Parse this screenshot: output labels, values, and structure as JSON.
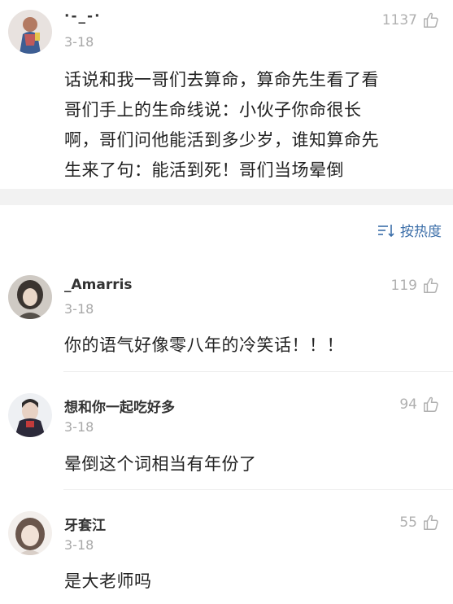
{
  "top_comment": {
    "username": "·-_-·",
    "date": "3-18",
    "likes": "1137",
    "text_lines": [
      "话说和我一哥们去算命，算命先生看了看",
      "哥们手上的生命线说：小伙子你命很长",
      "啊，哥们问他能活到多少岁，谁知算命先",
      "生来了句：能活到死！哥们当场晕倒"
    ]
  },
  "sort": {
    "label": "按热度",
    "icon": "sort-icon"
  },
  "replies": [
    {
      "username": "_Amarris",
      "date": "3-18",
      "likes": "119",
      "text": "你的语气好像零八年的冷笑话！！！"
    },
    {
      "username": "想和你一起吃好多",
      "date": "3-18",
      "likes": "94",
      "text": "晕倒这个词相当有年份了"
    },
    {
      "username": "牙套江",
      "date": "3-18",
      "likes": "55",
      "text": "是大老师吗"
    }
  ],
  "colors": {
    "link_blue": "#3b6ea8",
    "meta_grey": "#a8a8a8",
    "section_gap": "#f2f2f2"
  }
}
